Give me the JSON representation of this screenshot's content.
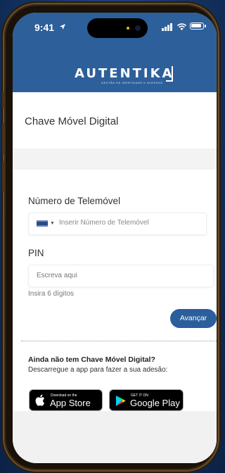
{
  "status_bar": {
    "time": "9:41"
  },
  "header": {
    "logo_text": "AUTENTIKA",
    "logo_subtitle": "GESTÃO DE IDENTIDADE E ACESSOS",
    "background_color": "#2d5f9a"
  },
  "page_title": "Chave Móvel Digital",
  "form": {
    "phone_label": "Número de Telemóvel",
    "phone_placeholder": "Inserir Número de Telemóvel",
    "pin_label": "PIN",
    "pin_placeholder": "Escreva aqui",
    "pin_help": "Insira 6 dígitos",
    "submit_label": "Avançar"
  },
  "promo": {
    "title": "Ainda não tem Chave Móvel Digital?",
    "text": "Descarregue a app para fazer a sua adesão:",
    "app_store": {
      "small": "Download on the",
      "big": "App Store"
    },
    "google_play": {
      "small": "GET IT ON",
      "big": "Google Play"
    }
  },
  "colors": {
    "accent": "#2b5e9c"
  }
}
